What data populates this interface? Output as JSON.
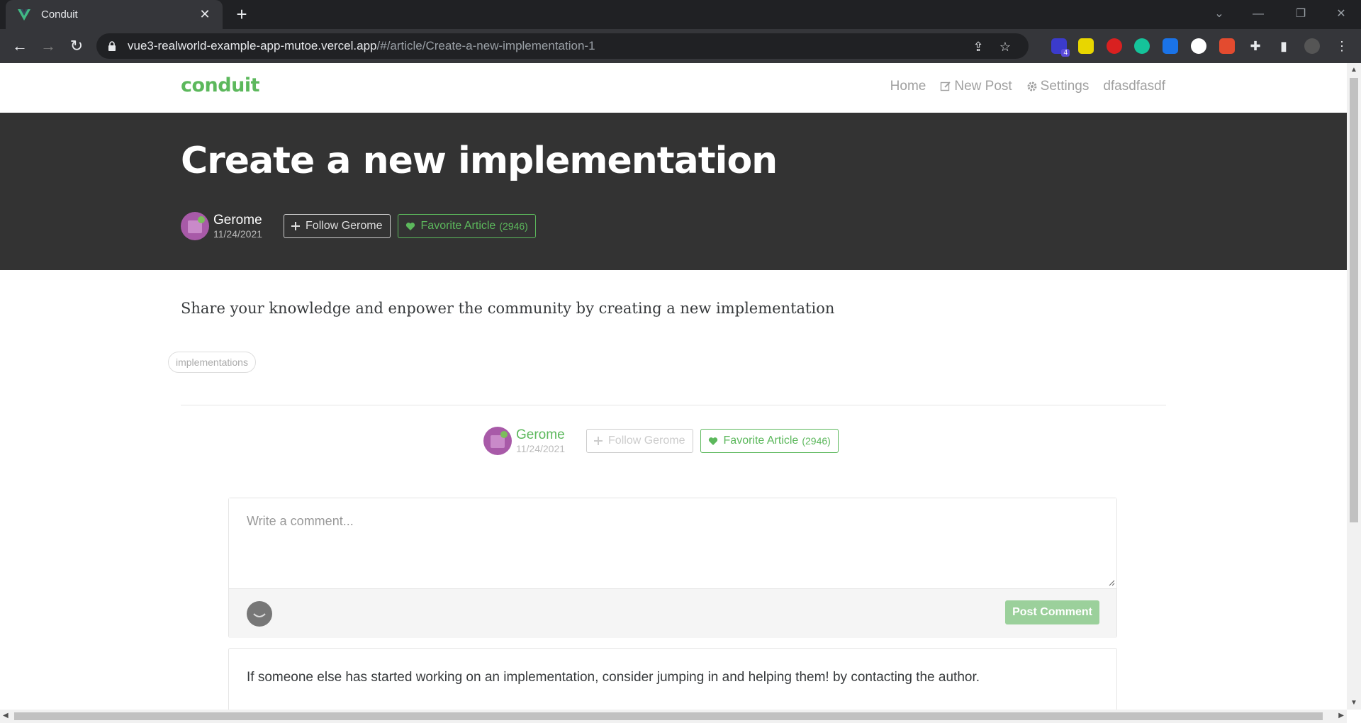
{
  "browser": {
    "tab_title": "Conduit",
    "url_host": "vue3-realworld-example-app-mutoe.vercel.app",
    "url_path": "/#/article/Create-a-new-implementation-1",
    "extension_badge": "4"
  },
  "navbar": {
    "brand": "conduit",
    "links": [
      "Home",
      "New Post",
      "Settings",
      "dfasdfasdf"
    ]
  },
  "article": {
    "title": "Create a new implementation",
    "author": "Gerome",
    "date": "11/24/2021",
    "follow_label": "Follow Gerome",
    "favorite_label": "Favorite Article",
    "favorite_count": "(2946)",
    "body": "Share your knowledge and enpower the community by creating a new implementation",
    "tag": "implementations"
  },
  "comment_form": {
    "placeholder": "Write a comment...",
    "submit_label": "Post Comment"
  },
  "comments": [
    {
      "body": "If someone else has started working on an implementation, consider jumping in and helping them! by contacting the author."
    }
  ],
  "colors": {
    "brand_green": "#5cb85c",
    "banner_bg": "#333333",
    "chrome_bg": "#35363a"
  }
}
